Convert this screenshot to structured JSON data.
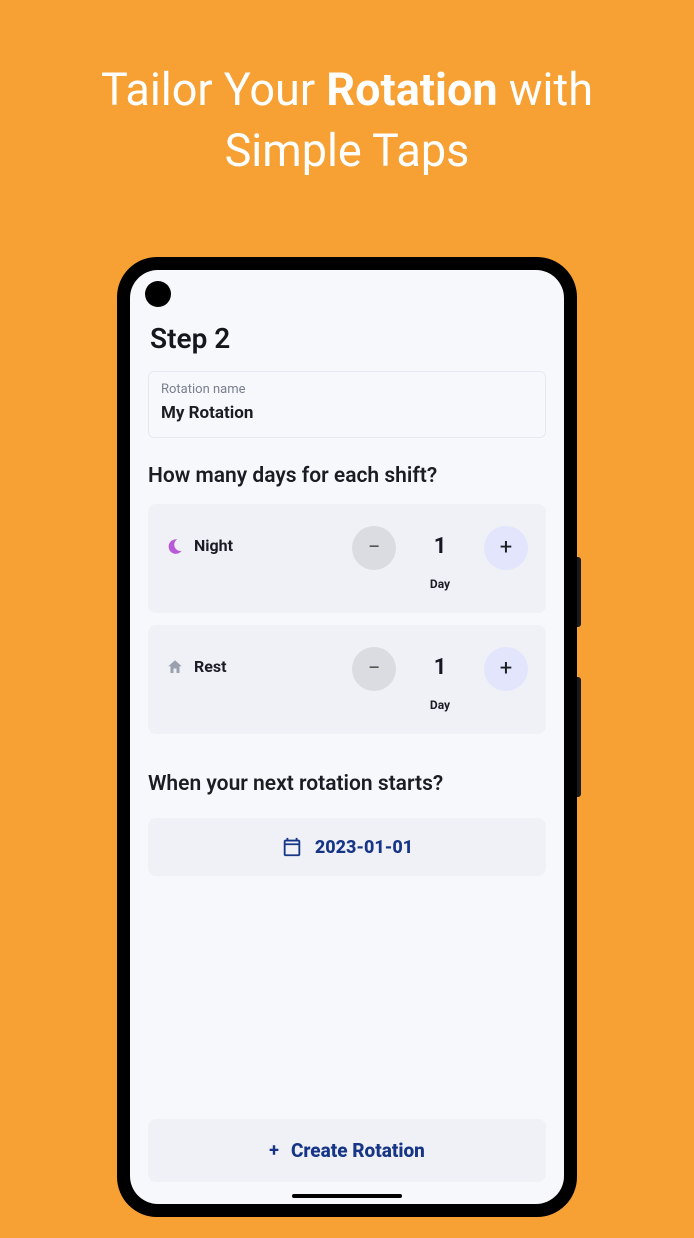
{
  "marketing": {
    "line1a": "Tailor Your ",
    "line1b": "Rotation",
    "line1c": " with",
    "line2": "Simple Taps"
  },
  "screen": {
    "step_title": "Step 2",
    "rotation_name_label": "Rotation name",
    "rotation_name_value": "My Rotation",
    "shift_question": "How many days for each shift?",
    "shifts": [
      {
        "name": "Night",
        "count": "1",
        "unit": "Day"
      },
      {
        "name": "Rest",
        "count": "1",
        "unit": "Day"
      }
    ],
    "start_question": "When your next rotation starts?",
    "start_date": "2023-01-01",
    "create_label": "Create Rotation",
    "plus_sign": "+",
    "minus_sign": "−"
  }
}
